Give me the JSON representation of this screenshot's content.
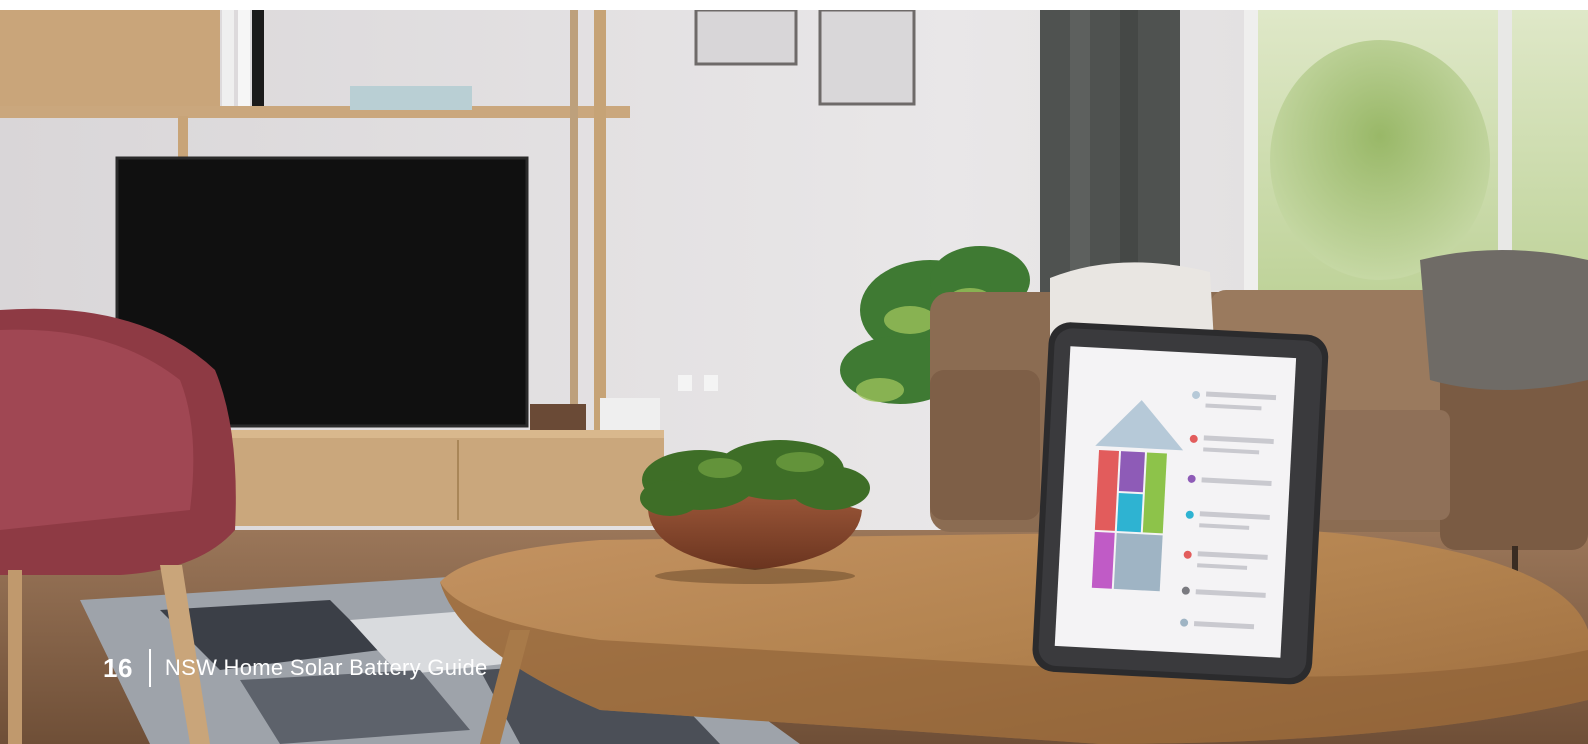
{
  "page": {
    "number": "16",
    "title": "NSW Home Solar Battery Guide"
  },
  "photo": {
    "subject": "living room with smart home energy tablet"
  },
  "colors": {
    "footer_text": "#ffffff",
    "wall": "#e6e4e6",
    "floor": "#7a5a3f",
    "table_wood": "#b08052",
    "sofa": "#8b6c52",
    "armchair": "#8e3a44"
  }
}
